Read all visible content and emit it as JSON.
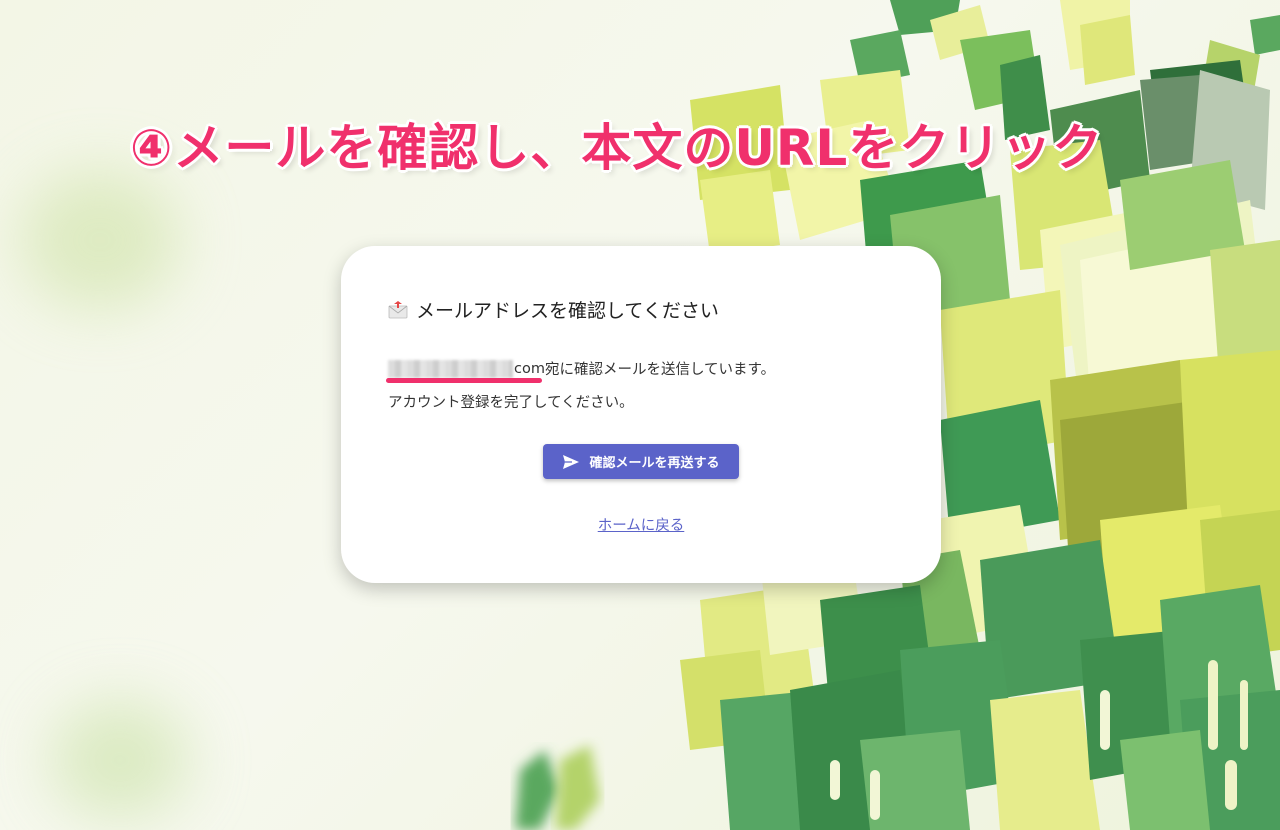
{
  "instruction": {
    "text": "④メールを確認し、本文のURLをクリック",
    "color": "#f0306c"
  },
  "card": {
    "title": "メールアドレスを確認してください",
    "title_icon": "envelope-icon",
    "email_suffix": "com",
    "message_line1": " 宛に確認メールを送信しています。",
    "message_line2": "アカウント登録を完了してください。",
    "resend_button_label": "確認メールを再送する",
    "resend_button_icon": "send-icon",
    "home_link_label": "ホームに戻る"
  },
  "colors": {
    "accent": "#5b63c9",
    "highlight": "#f0306c",
    "card_bg": "#ffffff"
  }
}
